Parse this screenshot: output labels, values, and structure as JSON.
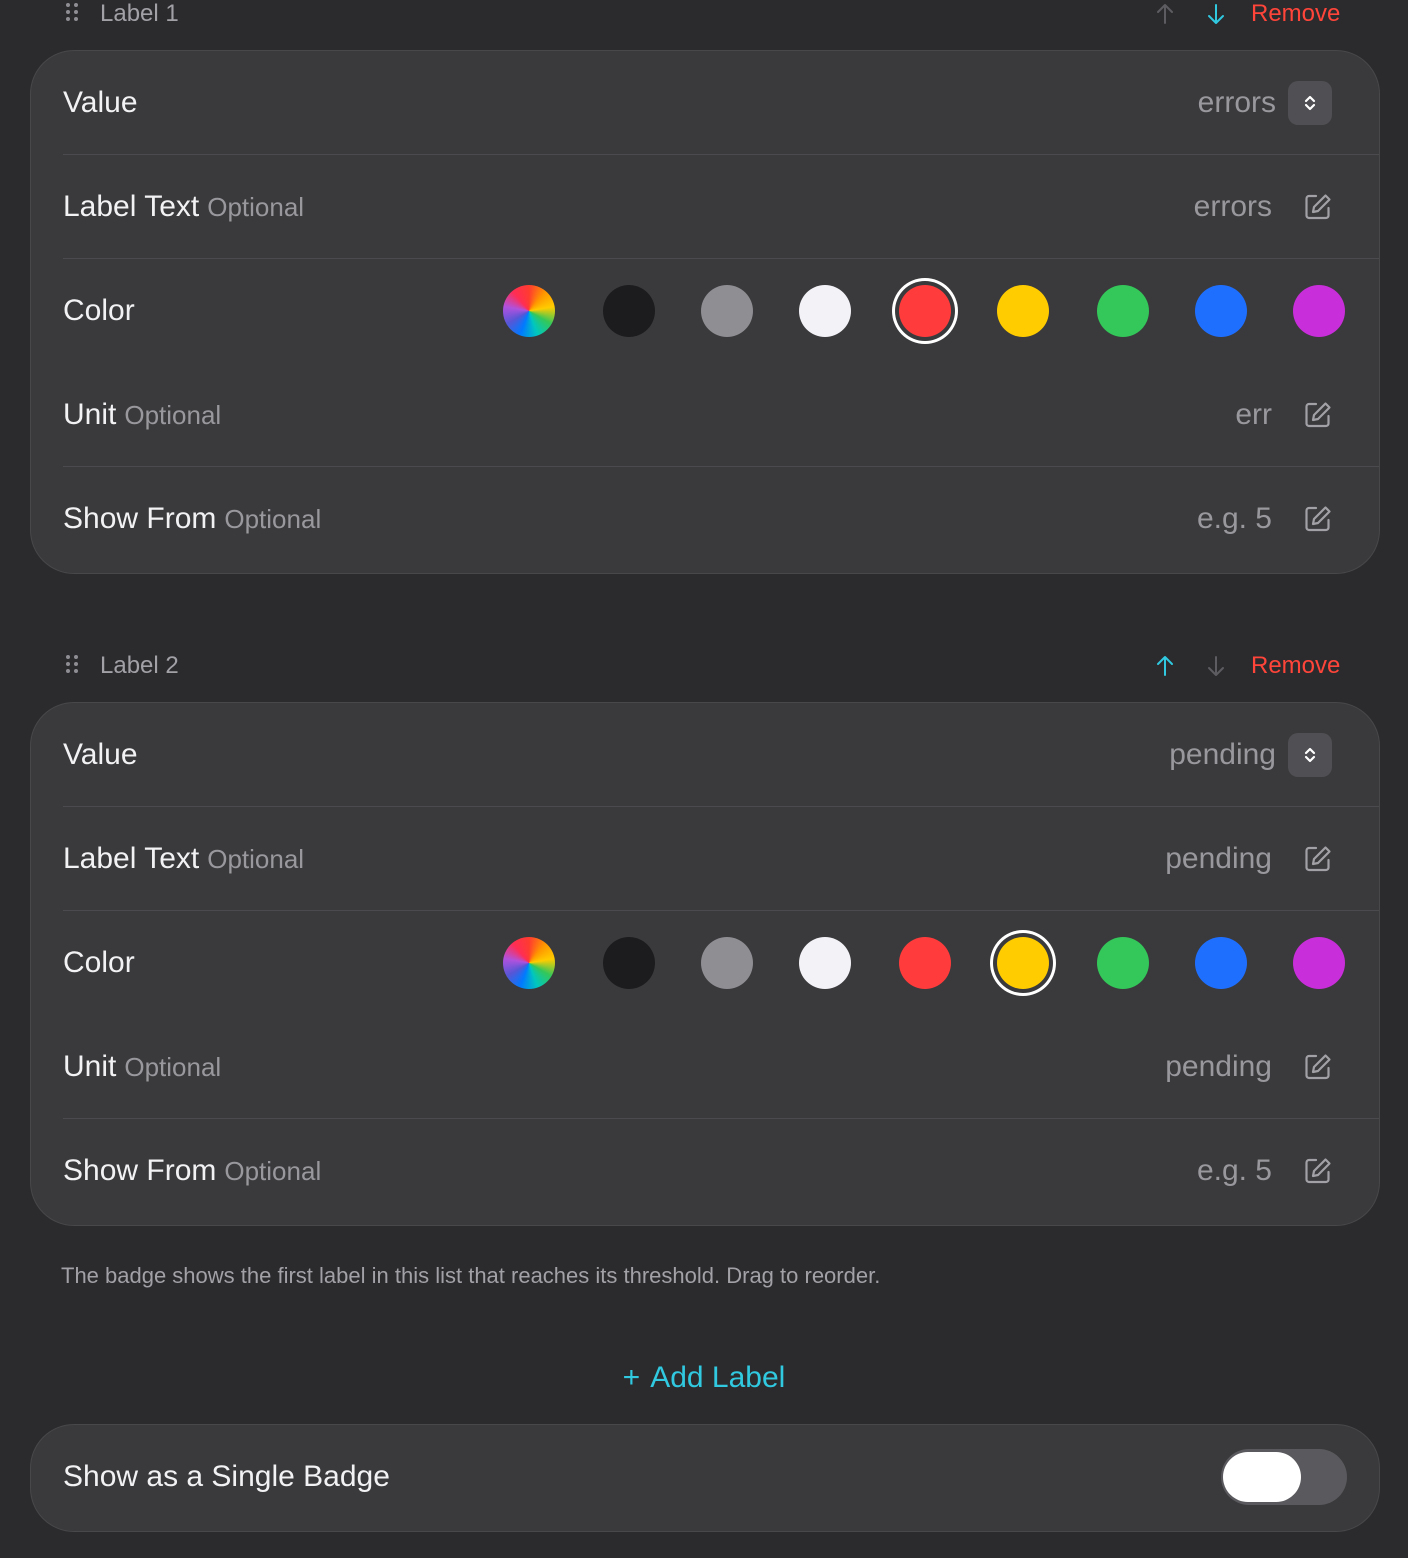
{
  "labels": [
    {
      "title": "Label 1",
      "remove": "Remove",
      "up_active": false,
      "down_active": true,
      "value_label": "Value",
      "value": "errors",
      "label_text_label": "Label Text",
      "label_text_optional": "Optional",
      "label_text_value": "errors",
      "color_label": "Color",
      "selected_color": "red",
      "unit_label": "Unit",
      "unit_optional": "Optional",
      "unit_value": "err",
      "show_from_label": "Show From",
      "show_from_optional": "Optional",
      "show_from_placeholder": "e.g. 5"
    },
    {
      "title": "Label 2",
      "remove": "Remove",
      "up_active": true,
      "down_active": false,
      "value_label": "Value",
      "value": "pending",
      "label_text_label": "Label Text",
      "label_text_optional": "Optional",
      "label_text_value": "pending",
      "color_label": "Color",
      "selected_color": "yellow",
      "unit_label": "Unit",
      "unit_optional": "Optional",
      "unit_value": "pending",
      "show_from_label": "Show From",
      "show_from_optional": "Optional",
      "show_from_placeholder": "e.g. 5"
    }
  ],
  "colors": [
    {
      "name": "multicolor",
      "hex": "conic"
    },
    {
      "name": "black",
      "hex": "#1c1c1e"
    },
    {
      "name": "gray",
      "hex": "#8e8e93"
    },
    {
      "name": "white",
      "hex": "#f2f2f7"
    },
    {
      "name": "red",
      "hex": "#ff3b3b"
    },
    {
      "name": "yellow",
      "hex": "#ffcc00"
    },
    {
      "name": "green",
      "hex": "#34c759"
    },
    {
      "name": "blue",
      "hex": "#1f6fff"
    },
    {
      "name": "purple",
      "hex": "#c82ed9"
    }
  ],
  "footnote": "The badge shows the first label in this list that reaches its threshold. Drag to reorder.",
  "add_label": "Add Label",
  "add_label_plus": "+",
  "single_badge": {
    "label": "Show as a Single Badge",
    "enabled": false
  },
  "accent": "#30c9e0",
  "destructive": "#ff453a"
}
